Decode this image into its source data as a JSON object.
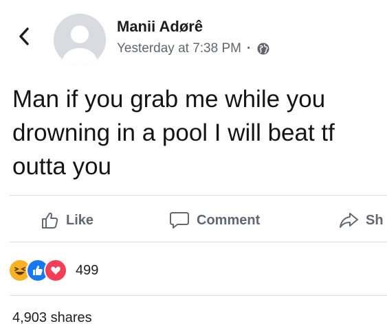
{
  "post": {
    "author": "Manii Adørê",
    "timestamp": "Yesterday at 7:38 PM",
    "separator": "·",
    "privacy_icon": "globe-icon",
    "text": "Man if you grab me while you drowning in a pool I will beat tf outta you"
  },
  "actions": [
    {
      "label": "Like",
      "icon": "thumbs-up-icon"
    },
    {
      "label": "Comment",
      "icon": "comment-icon"
    },
    {
      "label": "Sh",
      "icon": "share-icon"
    }
  ],
  "reactions": {
    "icons": [
      "haha-icon",
      "like-icon",
      "love-icon"
    ],
    "count": "499"
  },
  "shares": "4,903 shares",
  "colors": {
    "text": "#1c1e21",
    "secondary": "#62666c",
    "divider": "#dadde1",
    "like_blue": "#1877f2",
    "love_red": "#f33e58",
    "haha_yellow": "#f7b125"
  }
}
